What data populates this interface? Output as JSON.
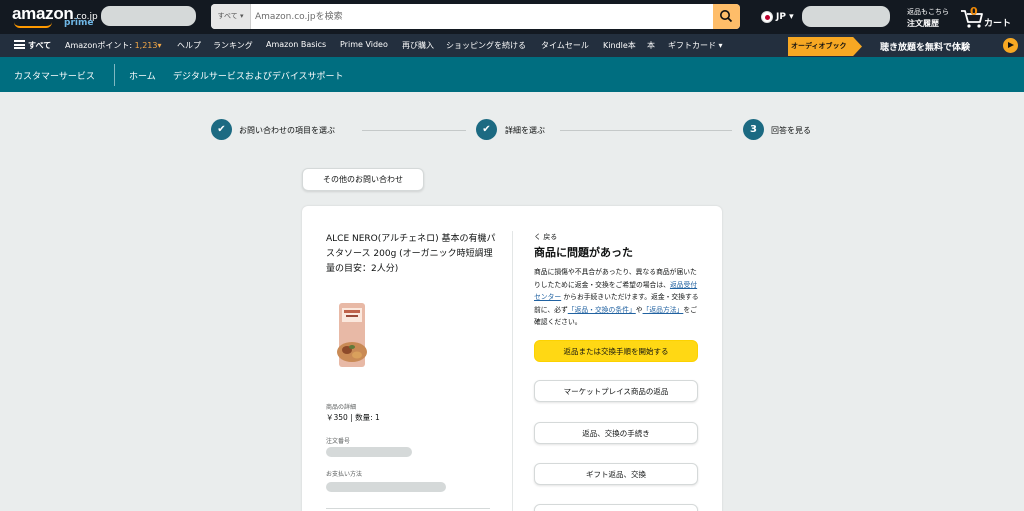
{
  "header": {
    "logo": "amazon",
    "logo_tld": ".co.jp",
    "logo_prime": "prime",
    "search": {
      "department": "すべて ▾",
      "placeholder": "Amazon.co.jpを検索"
    },
    "language": "JP ▾",
    "returns_line1": "返品もこちら",
    "returns_line2": "注文履歴",
    "cart_count": "0",
    "cart_label": "カート"
  },
  "nav": {
    "all": "すべて",
    "points_label": "Amazonポイント: ",
    "points_value": "1,213",
    "items": [
      "ヘルプ",
      "ランキング",
      "Amazon Basics",
      "Prime Video",
      "再び購入",
      "ショッピングを続ける",
      "タイムセール",
      "Kindle本",
      "本",
      "ギフトカード ▾"
    ],
    "audible_badge": "オーディオブック",
    "audible_text": "聴き放題を無料で体験"
  },
  "subnav": {
    "title": "カスタマーサービス",
    "home": "ホーム",
    "digital": "デジタルサービスおよびデバイスサポート"
  },
  "steps": [
    {
      "marker": "✔",
      "label": "お問い合わせの項目を選ぶ"
    },
    {
      "marker": "✔",
      "label": "詳細を選ぶ"
    },
    {
      "marker": "3",
      "label": "回答を見る"
    }
  ],
  "other_inquiry_button": "その他のお問い合わせ",
  "product": {
    "title": "ALCE NERO(アルチェネロ) 基本の有機パスタソース 200g (オーガニック時短調理 量の目安：2人分)",
    "details_label": "商品の詳細",
    "price_qty": "￥350 | 数量: 1",
    "order_label": "注文番号",
    "payment_label": "お支払い方法"
  },
  "panel": {
    "back": "く 戻る",
    "title": "商品に問題があった",
    "desc_1": "商品に損傷や不具合があったり、異なる商品が届いたりしたために返金・交換をご希望の場合は、",
    "link_1": "返品受付センター",
    "desc_2": " からお手続きいただけます。返金・交換する前に、必ず",
    "link_2": "「返品・交換の条件」",
    "desc_3": "や",
    "link_3": "「返品方法」",
    "desc_4": "をご確認ください。",
    "buttons": [
      "返品または交換手順を開始する",
      "マーケットプレイス商品の返品",
      "返品、交換の手続き",
      "ギフト返品、交換"
    ]
  },
  "colors": {
    "header_bg": "#131921",
    "nav_bg": "#232f3e",
    "teal_bg": "#006e80",
    "primary_button": "#ffd814",
    "link": "#2162a1",
    "step_circle": "#1c6a82"
  }
}
